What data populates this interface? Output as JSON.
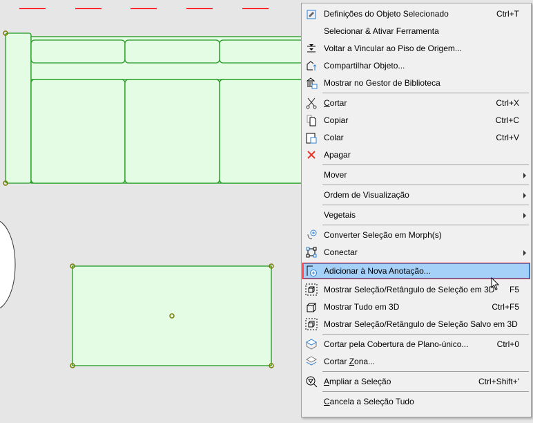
{
  "menu": {
    "items": [
      {
        "label": "Definições do Objeto Selecionado",
        "shortcut": "Ctrl+T",
        "icon": "object-settings-icon"
      },
      {
        "label": "Selecionar & Ativar Ferramenta",
        "shortcut": "",
        "icon": ""
      },
      {
        "label": "Voltar a Vincular ao Piso de Origem...",
        "shortcut": "",
        "icon": "relink-floor-icon"
      },
      {
        "label": "Compartilhar Objeto...",
        "shortcut": "",
        "icon": "share-object-icon"
      },
      {
        "label": "Mostrar no Gestor de Biblioteca",
        "shortcut": "",
        "icon": "library-manager-icon",
        "sepAfter": true
      },
      {
        "label": "Cortar",
        "shortcut": "Ctrl+X",
        "icon": "scissors-icon",
        "ul": 0
      },
      {
        "label": "Copiar",
        "shortcut": "Ctrl+C",
        "icon": "copy-icon"
      },
      {
        "label": "Colar",
        "shortcut": "Ctrl+V",
        "icon": "paste-icon"
      },
      {
        "label": "Apagar",
        "shortcut": "",
        "icon": "delete-x-icon",
        "sepAfter": true
      },
      {
        "label": "Mover",
        "shortcut": "",
        "icon": "",
        "submenu": true,
        "sepAfter": true
      },
      {
        "label": "Ordem de Visualização",
        "shortcut": "",
        "icon": "",
        "submenu": true,
        "sepAfter": true
      },
      {
        "label": "Vegetais",
        "shortcut": "",
        "icon": "",
        "submenu": true,
        "sepAfter": true
      },
      {
        "label": "Converter Seleção em Morph(s)",
        "shortcut": "",
        "icon": "morph-convert-icon"
      },
      {
        "label": "Conectar",
        "shortcut": "",
        "icon": "connect-icon",
        "submenu": true
      },
      {
        "label": "Adicionar à Nova Anotação...",
        "shortcut": "",
        "icon": "add-annotation-icon",
        "highlighted": true
      },
      {
        "label": "Mostrar Seleção/Retângulo de Seleção em 3D",
        "shortcut": "F5",
        "icon": "show-selection-3d-icon"
      },
      {
        "label": "Mostrar Tudo em 3D",
        "shortcut": "Ctrl+F5",
        "icon": "show-all-3d-icon"
      },
      {
        "label": "Mostrar Seleção/Retângulo de Seleção Salvo em 3D",
        "shortcut": "",
        "icon": "show-saved-selection-3d-icon",
        "sepAfter": true
      },
      {
        "label": "Cortar pela Cobertura de Plano-único...",
        "shortcut": "Ctrl+0",
        "icon": "trim-roof-icon"
      },
      {
        "label": "Cortar Zona...",
        "shortcut": "",
        "icon": "trim-zone-icon",
        "ul": 7,
        "sepAfter": true
      },
      {
        "label": "Ampliar a Seleção",
        "shortcut": "Ctrl+Shift+'",
        "icon": "zoom-selection-icon",
        "ul": 0,
        "sepAfter": true
      },
      {
        "label": "Cancela a Seleção Tudo",
        "shortcut": "",
        "icon": "",
        "ul": 0
      }
    ]
  },
  "colors": {
    "accent": "#a5d0f7",
    "highlight_border": "#e8141b",
    "object_fill": "#e4fbe4",
    "object_stroke": "#1e9a1e"
  }
}
